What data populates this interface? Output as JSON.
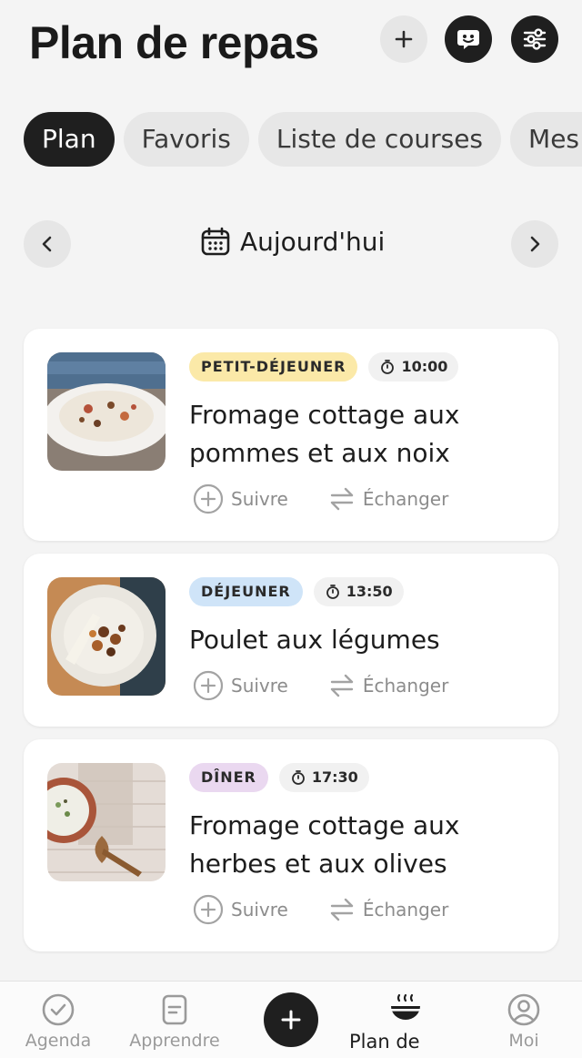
{
  "header": {
    "title": "Plan de repas",
    "icons": [
      "plus-icon",
      "chat-face-icon",
      "filter-sliders-icon"
    ]
  },
  "tabs": [
    {
      "label": "Plan",
      "active": true
    },
    {
      "label": "Favoris",
      "active": false
    },
    {
      "label": "Liste de courses",
      "active": false
    },
    {
      "label": "Mes r",
      "active": false
    }
  ],
  "date_nav": {
    "label": "Aujourd'hui",
    "icons": [
      "chevron-left-icon",
      "calendar-icon",
      "chevron-right-icon"
    ]
  },
  "meals": [
    {
      "badge": "PETIT-DÉJEUNER",
      "badge_color": "#fbe9a8",
      "time": "10:00",
      "title_line1": "Fromage cottage aux",
      "title_line2": "pommes et aux noix",
      "follow": "Suivre",
      "swap": "Échanger"
    },
    {
      "badge": "DÉJEUNER",
      "badge_color": "#cfe4f8",
      "time": "13:50",
      "title_line1": "Poulet aux légumes",
      "title_line2": "",
      "follow": "Suivre",
      "swap": "Échanger"
    },
    {
      "badge": "DÎNER",
      "badge_color": "#ead8f0",
      "time": "17:30",
      "title_line1": "Fromage cottage aux",
      "title_line2": "herbes et aux olives",
      "follow": "Suivre",
      "swap": "Échanger"
    }
  ],
  "bottom_nav": [
    {
      "label": "Agenda",
      "icon": "check-circle-icon"
    },
    {
      "label": "Apprendre",
      "icon": "note-icon"
    },
    {
      "label": "",
      "icon": "plus-icon"
    },
    {
      "label": "Plan de m...",
      "icon": "steaming-bowl-icon",
      "active": true
    },
    {
      "label": "Moi",
      "icon": "user-circle-icon"
    }
  ],
  "colors": {
    "dark": "#1f1f1f",
    "background": "#f4f4f4"
  }
}
